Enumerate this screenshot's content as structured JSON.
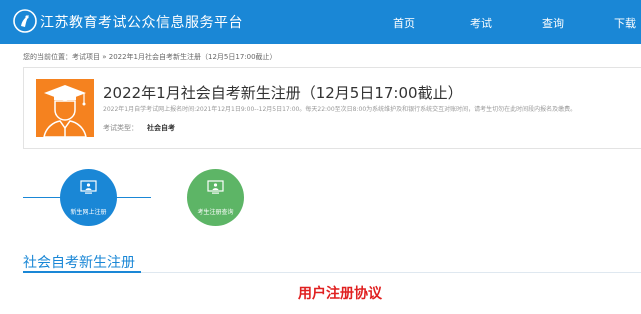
{
  "header": {
    "site_title": "江苏教育考试公众信息服务平台",
    "nav": [
      {
        "label": "首页"
      },
      {
        "label": "考试"
      },
      {
        "label": "查询"
      },
      {
        "label": "下载"
      }
    ],
    "colors": {
      "bar": "#1a87d6"
    }
  },
  "breadcrumb": {
    "prefix": "您的当前位置：",
    "items": [
      "考试项目",
      "2022年1月社会自考新生注册（12月5日17:00截止）"
    ],
    "separator": " » "
  },
  "card": {
    "title": "2022年1月社会自考新生注册（12月5日17:00截止）",
    "description": "2022年1月自学考试网上报名时间:2021年12月1日9:00--12月5日17:00。每天22:00至次日8:00为系统维护及和银行系统交互对账时间，请考生切勿在此时间段内报名及缴费。",
    "type_label": "考试类型：",
    "type_value": "社会自考",
    "avatar_color": "#f5821f"
  },
  "steps": [
    {
      "label": "新生网上注册",
      "icon": "monitor-icon",
      "color": "#1a87d6"
    },
    {
      "label": "考生注册查询",
      "icon": "monitor-icon",
      "color": "#5db566"
    }
  ],
  "section": {
    "title": "社会自考新生注册",
    "agreement_title": "用户注册协议"
  }
}
